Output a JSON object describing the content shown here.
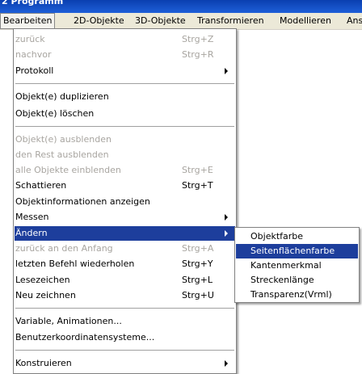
{
  "window": {
    "title": "2 Programm"
  },
  "menubar": {
    "items": [
      {
        "label": "Bearbeiten"
      },
      {
        "label": "2D-Objekte"
      },
      {
        "label": "3D-Objekte"
      },
      {
        "label": "Transformieren"
      },
      {
        "label": "Modellieren"
      },
      {
        "label": "Ans"
      }
    ]
  },
  "edit_menu": {
    "items": [
      {
        "label": "zurück",
        "shortcut": "Strg+Z",
        "disabled": true
      },
      {
        "label": "nachvor",
        "shortcut": "Strg+R",
        "disabled": true
      },
      {
        "label": "Protokoll",
        "submenu": true
      },
      {
        "label": "Objekt(e) duplizieren"
      },
      {
        "label": "Objekt(e) löschen"
      },
      {
        "label": "Objekt(e) ausblenden",
        "disabled": true
      },
      {
        "label": "den Rest ausblenden",
        "disabled": true
      },
      {
        "label": "alle Objekte einblenden",
        "shortcut": "Strg+E",
        "disabled": true
      },
      {
        "label": "Schattieren",
        "shortcut": "Strg+T"
      },
      {
        "label": "Objektinformationen anzeigen"
      },
      {
        "label": "Messen",
        "submenu": true
      },
      {
        "label": "Ändern",
        "submenu": true,
        "highlighted": true
      },
      {
        "label": "zurück an den Anfang",
        "shortcut": "Strg+A",
        "disabled": true
      },
      {
        "label": "letzten Befehl wiederholen",
        "shortcut": "Strg+Y"
      },
      {
        "label": "Lesezeichen",
        "shortcut": "Strg+L"
      },
      {
        "label": "Neu zeichnen",
        "shortcut": "Strg+U"
      },
      {
        "label": "Variable, Animationen..."
      },
      {
        "label": "Benutzerkoordinatensysteme..."
      },
      {
        "label": "Konstruieren",
        "submenu": true
      }
    ]
  },
  "aendern_submenu": {
    "items": [
      {
        "label": "Objektfarbe"
      },
      {
        "label": "Seitenflächenfarbe",
        "highlighted": true
      },
      {
        "label": "Kantenmerkmal"
      },
      {
        "label": "Streckenlänge"
      },
      {
        "label": "Transparenz(Vrml)"
      }
    ]
  },
  "colors": {
    "highlight": "#1d3e9c",
    "disabled_text": "#a8a5a0",
    "menubar_bg": "#ece9d8"
  }
}
